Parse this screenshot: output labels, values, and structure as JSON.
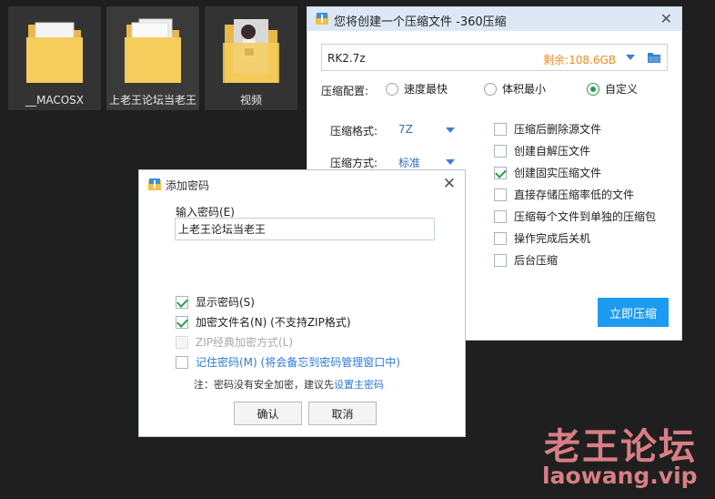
{
  "desktop": {
    "folders": [
      {
        "name": "__MACOSX"
      },
      {
        "name": "上老王论坛当老王"
      },
      {
        "name": "视频"
      }
    ]
  },
  "compress_window": {
    "title": "您将创建一个压缩文件 -360压缩",
    "close": "✕",
    "filename": "RK2.7z",
    "free_space": "剩余:108.6GB",
    "config_label": "压缩配置:",
    "radios": [
      {
        "label": "速度最快",
        "selected": false
      },
      {
        "label": "体积最小",
        "selected": false
      },
      {
        "label": "自定义",
        "selected": true
      }
    ],
    "format_label": "压缩格式:",
    "format_value": "7Z",
    "method_label": "压缩方式:",
    "method_value": "标准",
    "options": [
      {
        "label": "压缩后删除源文件",
        "checked": false
      },
      {
        "label": "创建自解压文件",
        "checked": false
      },
      {
        "label": "创建固实压缩文件",
        "checked": true
      },
      {
        "label": "直接存储压缩率低的文件",
        "checked": false
      },
      {
        "label": "压缩每个文件到单独的压缩包",
        "checked": false
      },
      {
        "label": "操作完成后关机",
        "checked": false
      },
      {
        "label": "后台压缩",
        "checked": false
      }
    ],
    "compress_button": "立即压缩"
  },
  "password_dialog": {
    "title": "添加密码",
    "close": "✕",
    "input_label": "输入密码(E)",
    "password_value": "上老王论坛当老王",
    "options": [
      {
        "label": "显示密码(S)",
        "checked": true,
        "enabled": true
      },
      {
        "label": "加密文件名(N) (不支持ZIP格式)",
        "checked": true,
        "enabled": true
      },
      {
        "label": "ZIP经典加密方式(L)",
        "checked": false,
        "enabled": false
      },
      {
        "label": "记住密码(M) (将会备忘到密码管理窗口中)",
        "checked": false,
        "enabled": true
      }
    ],
    "note_text": "注：密码没有安全加密，建议先",
    "note_link": "设置主密码",
    "ok_button": "确认",
    "cancel_button": "取消"
  },
  "watermark": {
    "text": "老王论坛",
    "url": "laowang.vip"
  },
  "colors": {
    "accent_blue": "#1d9bf0",
    "check_green": "#2a9d4a",
    "free_space_orange": "#f08a1e",
    "watermark": "#d87e85"
  }
}
